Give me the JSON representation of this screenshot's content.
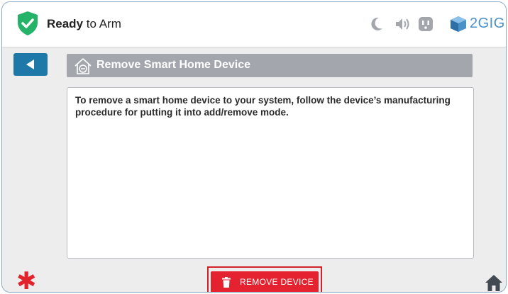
{
  "status": {
    "bold": "Ready",
    "rest": " to Arm"
  },
  "header_icons": [
    "moon-icon",
    "speaker-icon",
    "outlet-icon"
  ],
  "brand": {
    "name": "2GIG"
  },
  "page": {
    "title": "Remove Smart Home Device"
  },
  "content": {
    "instructions": "To remove a smart home device to your system, follow the device’s manufacturing procedure for putting it into add/remove mode."
  },
  "actions": {
    "remove_label": "REMOVE DEVICE"
  },
  "colors": {
    "accent": "#1e79a8",
    "ready_green": "#24b368",
    "danger_red": "#e52230",
    "title_bar": "#a3a7ad",
    "brand_blue": "#4a90c9"
  }
}
